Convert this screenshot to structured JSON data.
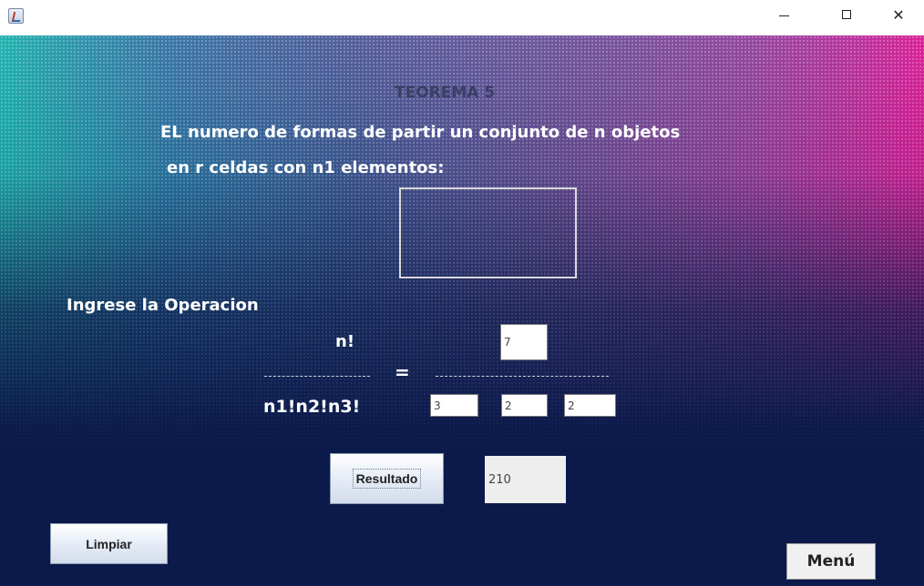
{
  "window": {
    "minimize_icon": "minimize-icon",
    "maximize_icon": "maximize-icon",
    "close_glyph": "✕"
  },
  "content": {
    "title": "TEOREMA 5",
    "statement_line1": "EL numero de formas de partir un conjunto de n objetos",
    "statement_line2": "en r celdas con n1 elementos:",
    "prompt": "Ingrese la Operacion",
    "numerator_label": "n!",
    "denominator_label": "n1!n2!n3!",
    "equals": "=",
    "inputs": {
      "n": "7",
      "n1": "3",
      "n2": "2",
      "n3": "2"
    },
    "result_value": "210",
    "colors": {
      "background_bottom": "#0b1a4a",
      "gradient_left": "#1fb8b0",
      "gradient_right": "#e0209a",
      "title_color": "#3a3f63"
    }
  },
  "buttons": {
    "resultado": "Resultado",
    "limpiar": "Limpiar",
    "menu": "Menú"
  }
}
